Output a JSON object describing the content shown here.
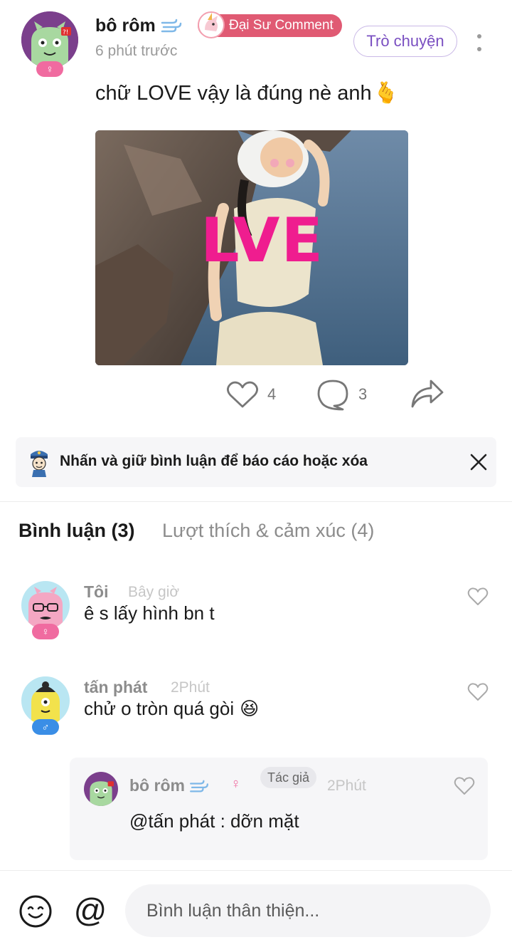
{
  "post": {
    "author_name": "bô rôm",
    "author_gender_symbol": "♀",
    "time": "6 phút trước",
    "title_badge": "Đại Sư Comment",
    "chat_button": "Trò chuyện",
    "text": "chữ LOVE vậy là đúng nè anh",
    "text_emoji": "🫰",
    "photo_overlay_text": "LVE",
    "likes": "4",
    "comments": "3"
  },
  "tip": {
    "text": "Nhấn và giữ bình luận để báo cáo hoặc xóa"
  },
  "tabs": {
    "comments": "Bình luận (3)",
    "reactions": "Lượt thích & cảm xúc (4)"
  },
  "comments": [
    {
      "name": "Tôi",
      "time": "Bây giờ",
      "text": "ê s lấy hình bn t",
      "gender_symbol": "♀"
    },
    {
      "name": "tấn phát",
      "time": "2Phút",
      "text": "chử o tròn quá gòi",
      "emoji": "😆",
      "gender_symbol": "♂"
    }
  ],
  "reply": {
    "name": "bô rôm",
    "author_tag": "Tác giả",
    "time": "2Phút",
    "text": "@tấn phát : dỡn mặt",
    "gender_symbol": "♀"
  },
  "composer": {
    "mention_symbol": "@",
    "placeholder": "Bình luận thân thiện..."
  },
  "colors": {
    "accent_purple": "#7a4fc1",
    "title_badge": "#e05a73",
    "love_pink": "#ef1d8f",
    "female_badge": "#f06ba0",
    "male_badge": "#3a8ee6"
  }
}
